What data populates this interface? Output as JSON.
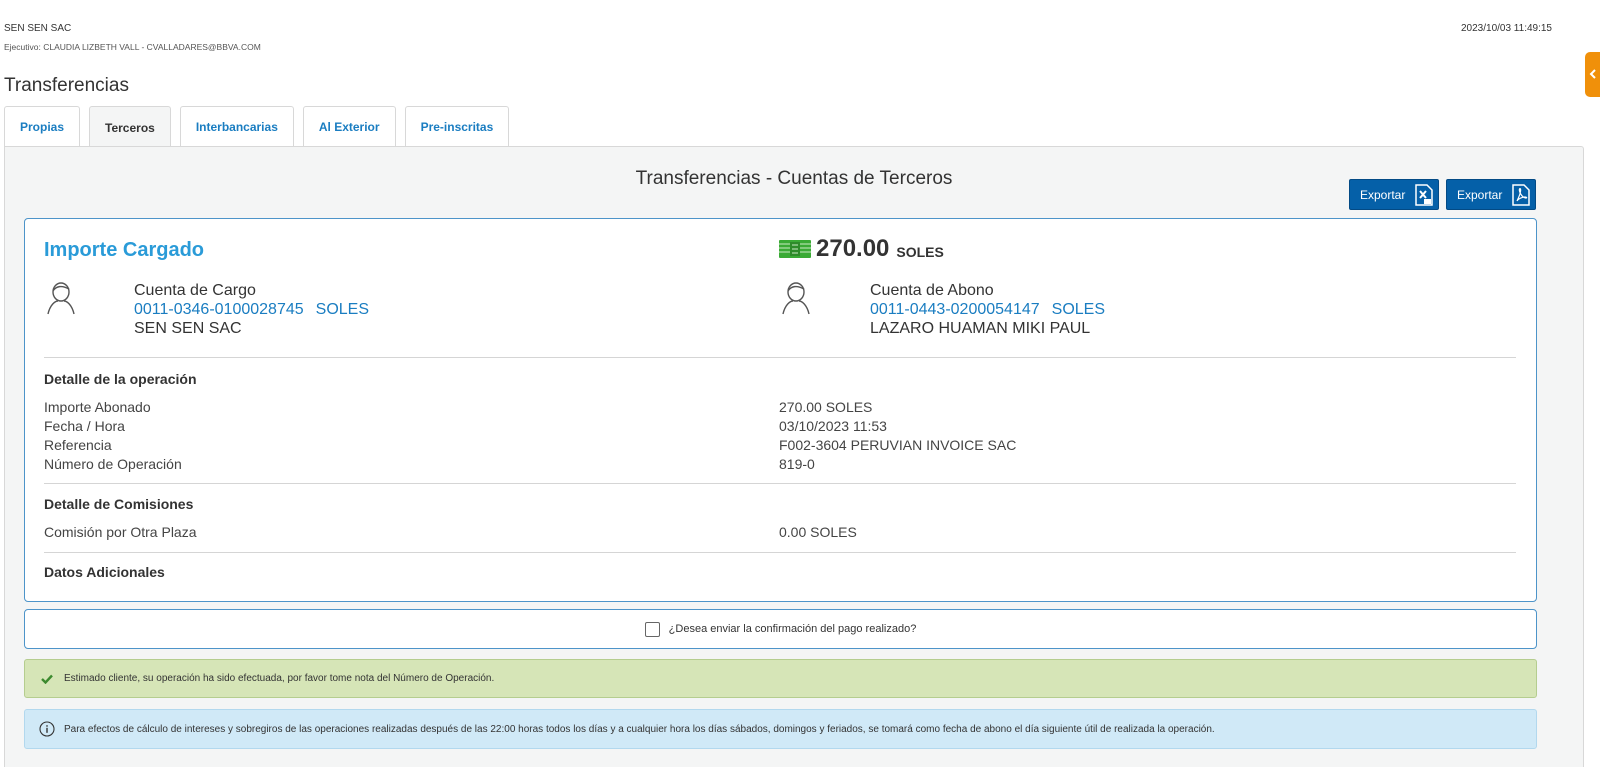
{
  "header": {
    "company": "SEN SEN SAC",
    "executive": "Ejecutivo: CLAUDIA LIZBETH VALL - CVALLADARES@BBVA.COM",
    "datetime": "2023/10/03 11:49:15"
  },
  "page_title": "Transferencias",
  "tabs": [
    {
      "label": "Propias",
      "active": false
    },
    {
      "label": "Terceros",
      "active": true
    },
    {
      "label": "Interbancarias",
      "active": false
    },
    {
      "label": "Al Exterior",
      "active": false
    },
    {
      "label": "Pre-inscritas",
      "active": false
    }
  ],
  "panel": {
    "title": "Transferencias - Cuentas de Terceros",
    "export_excel_label": "Exportar",
    "export_pdf_label": "Exportar"
  },
  "summary": {
    "importe_label": "Importe Cargado",
    "amount": "270.00",
    "currency": "SOLES",
    "cargo": {
      "label": "Cuenta de Cargo",
      "number": "0011-0346-0100028745",
      "currency": "SOLES",
      "holder": "SEN SEN SAC"
    },
    "abono": {
      "label": "Cuenta de Abono",
      "number": "0011-0443-0200054147",
      "currency": "SOLES",
      "holder": "LAZARO HUAMAN MIKI PAUL"
    }
  },
  "detalle_operacion": {
    "title": "Detalle de la operación",
    "rows": [
      {
        "label": "Importe Abonado",
        "value": "270.00  SOLES"
      },
      {
        "label": "Fecha / Hora",
        "value": "03/10/2023   11:53"
      },
      {
        "label": "Referencia",
        "value": "F002-3604 PERUVIAN INVOICE SAC"
      },
      {
        "label": "Número de Operación",
        "value": "819-0"
      }
    ]
  },
  "detalle_comisiones": {
    "title": "Detalle de Comisiones",
    "rows": [
      {
        "label": "Comisión por Otra Plaza",
        "value": "0.00   SOLES"
      }
    ]
  },
  "datos_adicionales": {
    "title": "Datos Adicionales"
  },
  "confirmation": {
    "label": "¿Desea enviar la confirmación del pago realizado?",
    "checked": false
  },
  "alerts": {
    "success": "Estimado cliente, su operación ha sido efectuada, por favor tome nota del Número de Operación.",
    "info": "Para efectos de cálculo de intereses y sobregiros de las operaciones realizadas después de las 22:00 horas todos los días y a cualquier hora los días sábados, domingos y feriados, se tomará como fecha de abono el día siguiente útil de realizada la operación."
  },
  "colors": {
    "accent_blue": "#1a7dc1",
    "button_blue": "#0560a8",
    "success_bg": "#d6e5b7",
    "info_bg": "#d0e9f7",
    "toggle_orange": "#f0900a",
    "money_green": "#3aaa35"
  },
  "icons": {
    "side_toggle": "chevron-left-icon",
    "export_excel": "excel-file-icon",
    "export_pdf": "pdf-file-icon",
    "amount": "money-icon",
    "account": "user-icon",
    "success": "check-icon",
    "info": "info-circle-icon"
  }
}
